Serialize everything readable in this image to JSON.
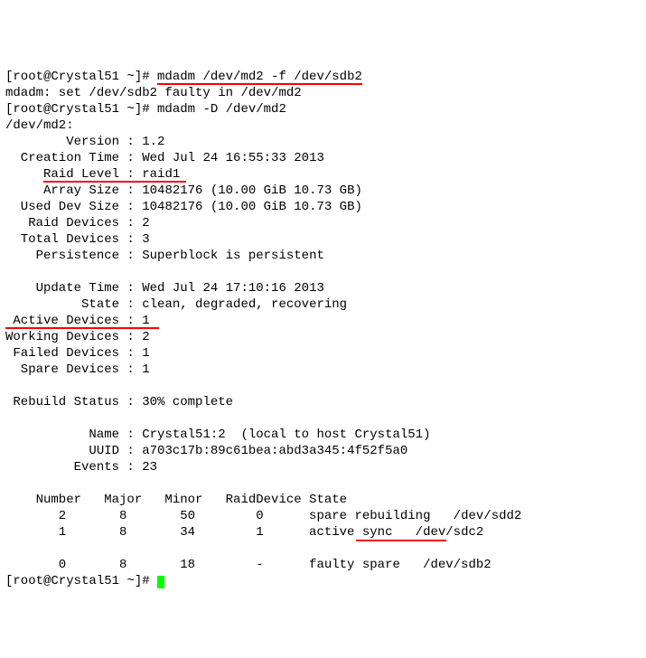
{
  "prompt": "[root@Crystal51 ~]# ",
  "cmd1": "mdadm /dev/md2 -f /dev/sdb2",
  "out1": "mdadm: set /dev/sdb2 faulty in /dev/md2",
  "cmd2": "mdadm -D /dev/md2",
  "device_header": "/dev/md2:",
  "fields": {
    "version_l": "        Version : ",
    "version_v": "1.2",
    "creation_l": "  Creation Time : ",
    "creation_v": "Wed Jul 24 16:55:33 2013",
    "raidlevel_l": "     Raid Level : ",
    "raidlevel_v": "raid1",
    "arraysize_l": "     Array Size : ",
    "arraysize_v": "10482176 (10.00 GiB 10.73 GB)",
    "useddev_l": "  Used Dev Size : ",
    "useddev_v": "10482176 (10.00 GiB 10.73 GB)",
    "raiddev_l": "   Raid Devices : ",
    "raiddev_v": "2",
    "totaldev_l": "  Total Devices : ",
    "totaldev_v": "3",
    "persist_l": "    Persistence : ",
    "persist_v": "Superblock is persistent",
    "update_l": "    Update Time : ",
    "update_v": "Wed Jul 24 17:10:16 2013",
    "state_l": "          State : ",
    "state_v": "clean, degraded, recovering",
    "active_l": " Active Devices : ",
    "active_v": "1",
    "working_l": "Working Devices : ",
    "working_v": "2",
    "failed_l": " Failed Devices : ",
    "failed_v": "1",
    "spare_l": "  Spare Devices : ",
    "spare_v": "1",
    "rebuild_l": " Rebuild Status : ",
    "rebuild_v": "30% complete",
    "name_l": "           Name : ",
    "name_v": "Crystal51:2  (local to host Crystal51)",
    "uuid_l": "           UUID : ",
    "uuid_v": "a703c17b:89c61bea:abd3a345:4f52f5a0",
    "events_l": "         Events : ",
    "events_v": "23"
  },
  "table": {
    "header": "    Number   Major   Minor   RaidDevice State",
    "rows": [
      "       2       8       50        0      spare rebuilding   /dev/sdd2",
      "       1       8       34        1      active sync   /dev/sdc2",
      "",
      "       0       8       18        -      faulty spare   /dev/sdb2"
    ]
  }
}
